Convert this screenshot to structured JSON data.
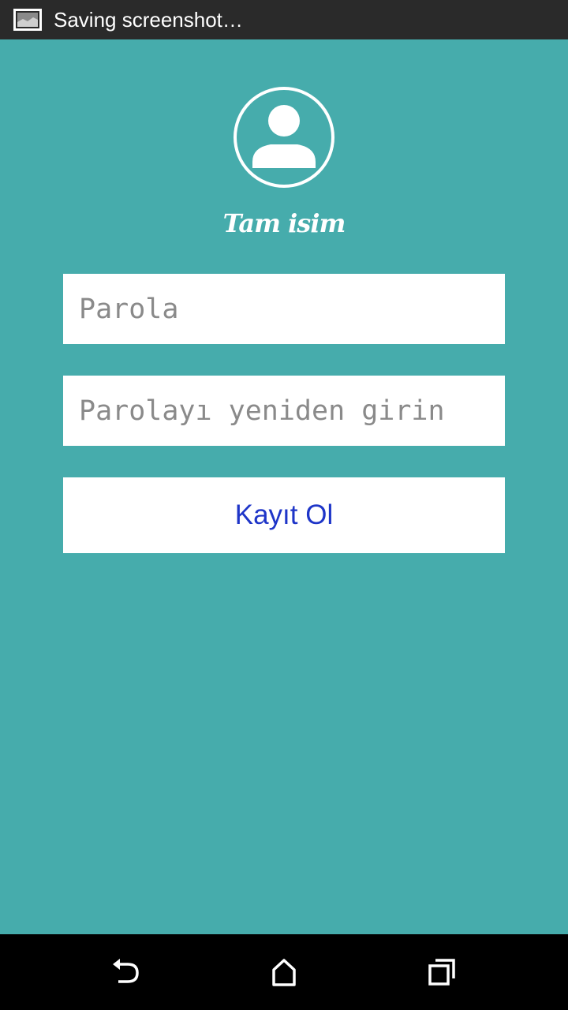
{
  "status_bar": {
    "notification_icon": "screenshot-icon",
    "text": "Saving screenshot…"
  },
  "profile": {
    "avatar_icon": "user-avatar-icon",
    "name": "Tam isim"
  },
  "form": {
    "password_placeholder": "Parola",
    "password_value": "",
    "confirm_placeholder": "Parolayı yeniden girin",
    "confirm_value": "",
    "register_label": "Kayıt Ol"
  },
  "colors": {
    "background": "#46acac",
    "button_text": "#1e35c8",
    "field_background": "#ffffff"
  },
  "nav_bar": {
    "back_icon": "back-icon",
    "home_icon": "home-icon",
    "recents_icon": "recents-icon"
  }
}
